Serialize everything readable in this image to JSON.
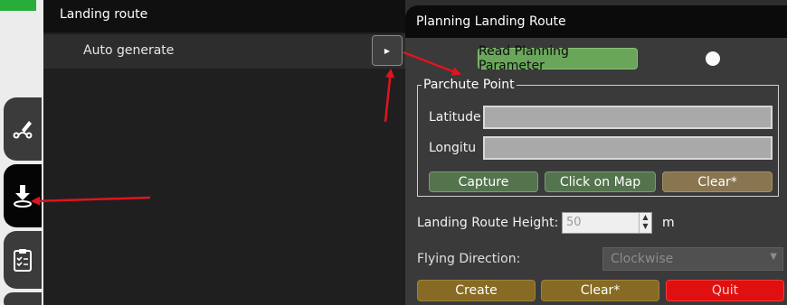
{
  "menu": {
    "header": "Landing route",
    "item_label": "Auto generate"
  },
  "panel": {
    "title": "Planning Landing Route",
    "read_button": "Read Planning Parameter",
    "parachute": {
      "legend": "Parchute Point",
      "latitude_label": "Latitude",
      "longitude_label": "Longitu",
      "capture_label": "Capture",
      "click_map_label": "Click on Map",
      "clear_label": "Clear*"
    },
    "height": {
      "label": "Landing Route Height:",
      "value": "50",
      "unit": "m"
    },
    "direction": {
      "label": "Flying Direction:",
      "selected": "Clockwise"
    },
    "actions": {
      "create_label": "Create",
      "clear_label": "Clear*",
      "quit_label": "Quit"
    }
  },
  "colors": {
    "accent_green": "#6aa65a",
    "button_green": "#54744e",
    "button_brown": "#876a24",
    "quit_red": "#e01010",
    "annotation_red": "#e0141e"
  }
}
